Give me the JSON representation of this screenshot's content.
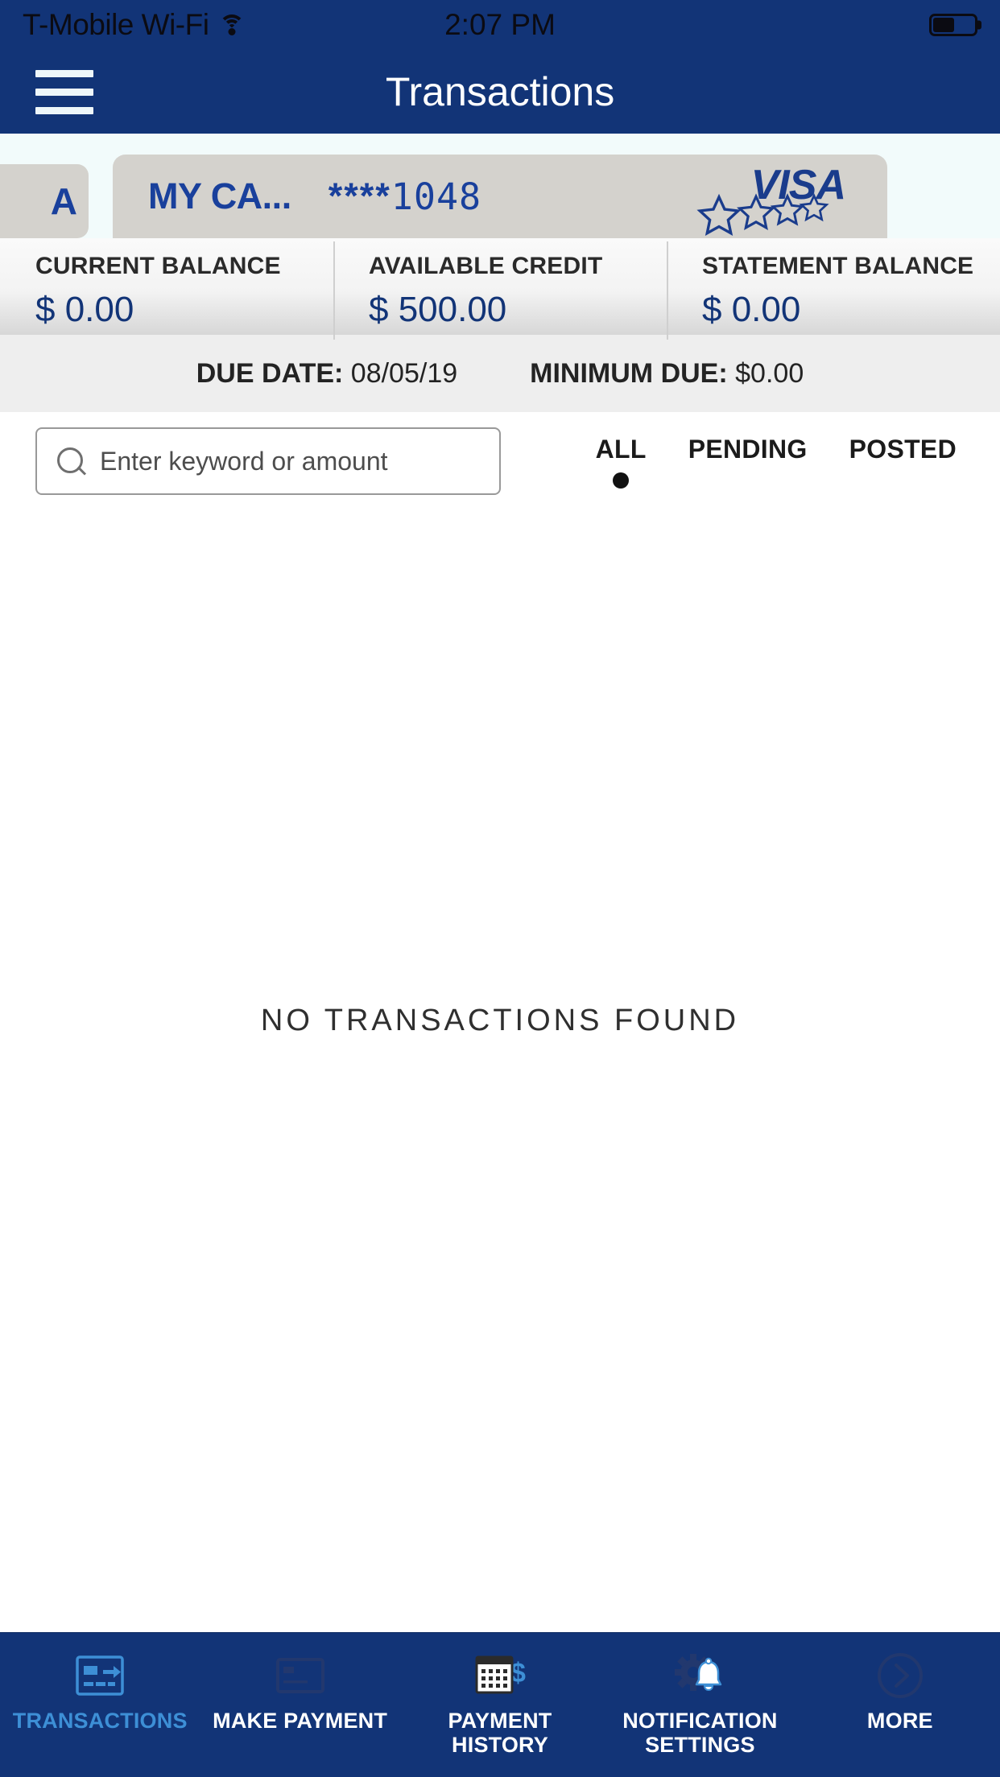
{
  "status_bar": {
    "carrier": "T-Mobile Wi-Fi",
    "wifi_icon": "wifi-icon",
    "time": "2:07 PM",
    "battery_icon": "battery-icon"
  },
  "nav": {
    "menu_icon": "hamburger-menu-icon",
    "title": "Transactions"
  },
  "carousel": {
    "previous_card_fragment": "A",
    "card": {
      "name": "MY CA...",
      "mask": "****",
      "last_four": "1048",
      "brand": "VISA",
      "brand_icon": "visa-logo"
    }
  },
  "balances": [
    {
      "label": "CURRENT BALANCE",
      "value": "$ 0.00"
    },
    {
      "label": "AVAILABLE CREDIT",
      "value": "$ 500.00"
    },
    {
      "label": "STATEMENT BALANCE",
      "value": "$ 0.00"
    }
  ],
  "due_row": {
    "due_date_label": "DUE DATE:",
    "due_date_value": "08/05/19",
    "minimum_due_label": "MINIMUM DUE:",
    "minimum_due_value": "$0.00"
  },
  "search": {
    "icon": "search-icon",
    "placeholder": "Enter keyword or amount",
    "value": ""
  },
  "filters": [
    {
      "label": "ALL",
      "selected": true
    },
    {
      "label": "PENDING",
      "selected": false
    },
    {
      "label": "POSTED",
      "selected": false
    }
  ],
  "content": {
    "empty_message": "NO TRANSACTIONS FOUND"
  },
  "tabbar": [
    {
      "label": "TRANSACTIONS",
      "icon": "card-arrow-icon",
      "active": true
    },
    {
      "label": "MAKE PAYMENT",
      "icon": "credit-card-icon",
      "active": false
    },
    {
      "label": "PAYMENT\nHISTORY",
      "icon": "calendar-dollar-icon",
      "active": false
    },
    {
      "label": "NOTIFICATION\nSETTINGS",
      "icon": "bell-gear-icon",
      "active": false
    },
    {
      "label": "MORE",
      "icon": "chevron-circle-icon",
      "active": false
    }
  ],
  "colors": {
    "brand_navy": "#123477",
    "card_grey": "#d4d2cd",
    "accent_blue": "#19409c",
    "active_tab": "#3d8fd6",
    "carousel_bg": "#f2fbfb"
  }
}
